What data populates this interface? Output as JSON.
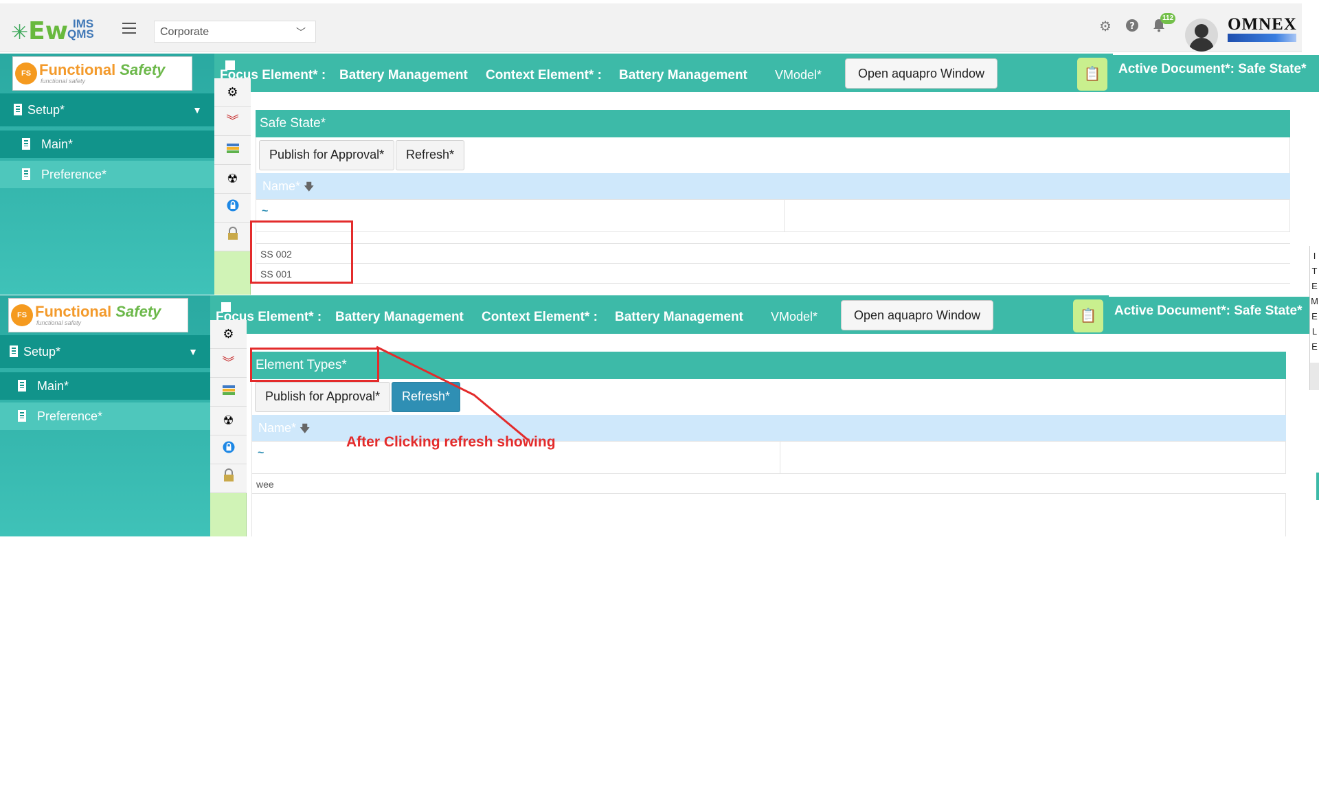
{
  "topbar": {
    "logo_main": "Ew",
    "logo_ims": "IMS",
    "logo_qms": "QMS",
    "company_select": "Corporate",
    "notification_count": "112",
    "brand_logo": "OMNEX",
    "icons": [
      "gear-icon",
      "help-icon",
      "bell-icon"
    ]
  },
  "panels": [
    {
      "logo_title": "Functional",
      "logo_title_2": "Safety",
      "logo_sub": "functional safety",
      "sidebar": {
        "setup_label": "Setup*",
        "items": [
          {
            "label": "Main*"
          },
          {
            "label": "Preference*"
          }
        ]
      },
      "focus": {
        "focus_label": "Focus Element* :",
        "focus_value": "Battery Management",
        "context_label": "Context Element* :",
        "context_value": "Battery Management",
        "vmodel": "VModel*",
        "open_button": "Open aquapro Window",
        "active_doc": "Active Document*: Safe State*"
      },
      "section_title": "Safe State*",
      "toolbar": {
        "publish": "Publish for Approval*",
        "refresh": "Refresh*"
      },
      "grid": {
        "column": "Name*",
        "filter": "~",
        "rows": [
          "SS 002",
          "SS 001"
        ]
      }
    },
    {
      "logo_title": "Functional",
      "logo_title_2": "Safety",
      "logo_sub": "functional safety",
      "sidebar": {
        "setup_label": "Setup*",
        "items": [
          {
            "label": "Main*"
          },
          {
            "label": "Preference*"
          }
        ]
      },
      "focus": {
        "focus_label": "Focus Element* :",
        "focus_value": "Battery Management",
        "context_label": "Context Element* :",
        "context_value": "Battery Management",
        "vmodel": "VModel*",
        "open_button": "Open aquapro Window",
        "active_doc": "Active Document*: Safe State*"
      },
      "section_title": "Element Types*",
      "toolbar": {
        "publish": "Publish for Approval*",
        "refresh": "Refresh*"
      },
      "grid": {
        "column": "Name*",
        "filter": "~",
        "rows": [
          "wee"
        ]
      }
    }
  ],
  "annotation": "After Clicking refresh showing",
  "side_tab_letters": [
    "I",
    "T",
    "E",
    "M",
    "E",
    "L",
    "E"
  ],
  "colors": {
    "teal": "#3dbaa8",
    "dark_teal": "#11948b",
    "annotation_red": "#e32b2b",
    "refresh_active": "#2f8fb4"
  }
}
